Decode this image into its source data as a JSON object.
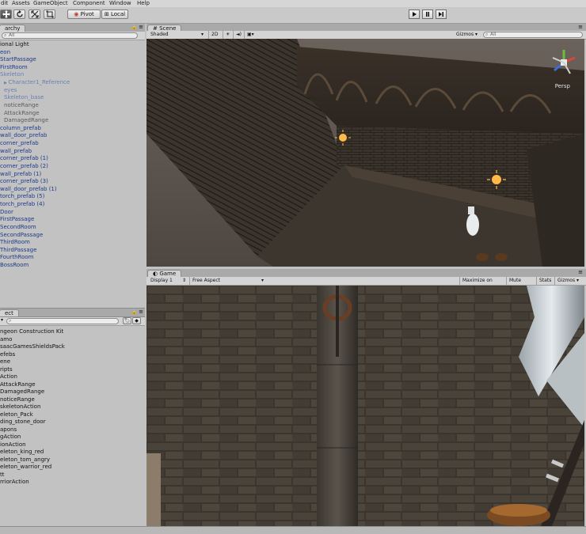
{
  "menu": [
    "dit",
    "Assets",
    "GameObject",
    "Component",
    "Window",
    "Help"
  ],
  "toolbar": {
    "tools": [
      "move-tool",
      "rotate-tool",
      "scale-tool",
      "rect-tool"
    ],
    "pivot_label": "Pivot",
    "local_label": "Local"
  },
  "hierarchy": {
    "tab": "archy",
    "search_placeholder": "All",
    "items": [
      {
        "label": "ional Light",
        "style": "normal",
        "indent": 0
      },
      {
        "label": "eon",
        "style": "blue",
        "indent": 0
      },
      {
        "label": "StartPassage",
        "style": "blue",
        "indent": 0
      },
      {
        "label": "FirstRoom",
        "style": "blue",
        "indent": 0
      },
      {
        "label": "Skeleton",
        "style": "pale",
        "indent": 0
      },
      {
        "label": "Character1_Reference",
        "style": "pale",
        "indent": 1,
        "arrow": true
      },
      {
        "label": "eyes",
        "style": "pale",
        "indent": 1
      },
      {
        "label": "Skeleton_base",
        "style": "pale",
        "indent": 1
      },
      {
        "label": "noticeRange",
        "style": "grey",
        "indent": 1
      },
      {
        "label": "AttackRange",
        "style": "grey",
        "indent": 1
      },
      {
        "label": "DamagedRange",
        "style": "grey",
        "indent": 1
      },
      {
        "label": "column_prefab",
        "style": "blue",
        "indent": 0
      },
      {
        "label": "wall_door_prefab",
        "style": "blue",
        "indent": 0
      },
      {
        "label": "corner_prefab",
        "style": "blue",
        "indent": 0
      },
      {
        "label": "wall_prefab",
        "style": "blue",
        "indent": 0
      },
      {
        "label": "corner_prefab (1)",
        "style": "blue",
        "indent": 0
      },
      {
        "label": "corner_prefab (2)",
        "style": "blue",
        "indent": 0
      },
      {
        "label": "wall_prefab (1)",
        "style": "blue",
        "indent": 0
      },
      {
        "label": "corner_prefab (3)",
        "style": "blue",
        "indent": 0
      },
      {
        "label": "wall_door_prefab (1)",
        "style": "blue",
        "indent": 0
      },
      {
        "label": "torch_prefab (5)",
        "style": "blue",
        "indent": 0
      },
      {
        "label": "torch_prefab (4)",
        "style": "blue",
        "indent": 0
      },
      {
        "label": "Door",
        "style": "blue",
        "indent": 0
      },
      {
        "label": "FirstPassage",
        "style": "blue",
        "indent": 0
      },
      {
        "label": "SecondRoom",
        "style": "blue",
        "indent": 0
      },
      {
        "label": "SecondPassage",
        "style": "blue",
        "indent": 0
      },
      {
        "label": "ThirdRoom",
        "style": "blue",
        "indent": 0
      },
      {
        "label": "ThirdPassage",
        "style": "blue",
        "indent": 0
      },
      {
        "label": "FourthRoom",
        "style": "blue",
        "indent": 0
      },
      {
        "label": "BossRoom",
        "style": "blue",
        "indent": 0
      }
    ]
  },
  "project": {
    "tab": "ect",
    "items": [
      "ngeon Construction Kit",
      "amo",
      "saacGamesShieldsPack",
      "efebs",
      "ene",
      "ripts",
      "Action",
      "AttackRange",
      "DamagedRange",
      "noticeRange",
      "skeletonAction",
      "eleton_Pack",
      "ding_stone_door",
      "apons",
      "gAction",
      "ionAction",
      "eleton_king_red",
      "eleton_tom_angry",
      "eleton_warrior_red",
      "tt",
      "rriorAction"
    ]
  },
  "scene": {
    "tab": "Scene",
    "shading": "Shaded",
    "mode_2d": "2D",
    "gizmos": "Gizmos",
    "search_placeholder": "All",
    "persp": "Persp"
  },
  "game": {
    "tab": "Game",
    "display": "Display 1",
    "aspect": "Free Aspect",
    "maximize": "Maximize on Play",
    "mute": "Mute audio",
    "stats": "Stats",
    "gizmos": "Gizmos"
  },
  "colors": {
    "hierarchy_blue": "#1e3a8a",
    "scene_bg": "#4a4440",
    "torch": "#ffb84a"
  }
}
